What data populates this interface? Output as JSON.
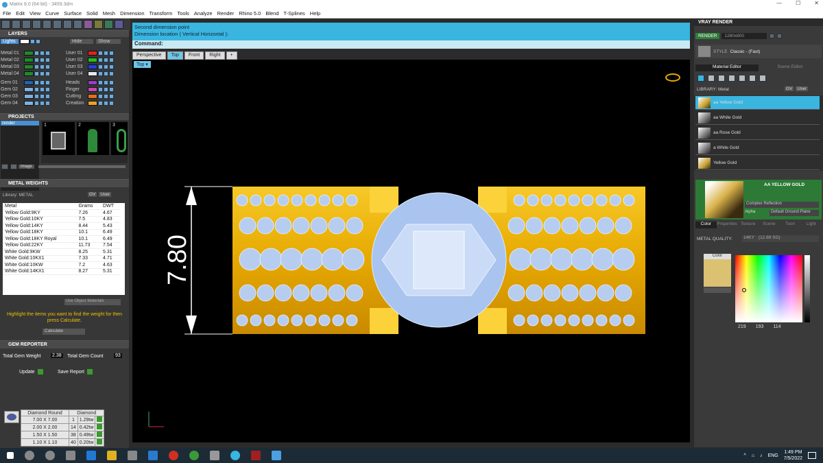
{
  "window": {
    "title": "Matrix 8.0 (64-bit) - 3459.3dm",
    "controls": [
      "—",
      "☐",
      "✕"
    ]
  },
  "menu": [
    "File",
    "Edit",
    "View",
    "Curve",
    "Surface",
    "Solid",
    "Mesh",
    "Dimension",
    "Transform",
    "Tools",
    "Analyze",
    "Render",
    "Rhino 5.0",
    "Blend",
    "T-Splines",
    "Help"
  ],
  "layers": {
    "title": "LAYERS",
    "lights": "Lights",
    "hide": "Hide",
    "show": "Show",
    "left_rows": [
      {
        "name": "Metal 01",
        "color": "#1e8a2a"
      },
      {
        "name": "Metal 02",
        "color": "#1e8a2a"
      },
      {
        "name": "Metal 03",
        "color": "#1e8a2a"
      },
      {
        "name": "Metal 04",
        "color": "#1e8a2a"
      },
      {
        "name": "Gem 01",
        "color": "#1e63b0"
      },
      {
        "name": "Gem 02",
        "color": "#7fb0e0"
      },
      {
        "name": "Gem 03",
        "color": "#7fb0e0"
      },
      {
        "name": "Gem 04",
        "color": "#7fb0e0"
      }
    ],
    "right_rows": [
      {
        "name": "User 01",
        "color": "#e02020"
      },
      {
        "name": "User 02",
        "color": "#20c020"
      },
      {
        "name": "User 03",
        "color": "#2040e0"
      },
      {
        "name": "User 04",
        "color": "#e8e8e8"
      },
      {
        "name": "Heads",
        "color": "#9a3cc0"
      },
      {
        "name": "Finger",
        "color": "#c04ab0"
      },
      {
        "name": "Cutting",
        "color": "#e07020"
      },
      {
        "name": "Creation",
        "color": "#f0a020"
      }
    ]
  },
  "projects": {
    "title": "PROJECTS",
    "item": "render",
    "thumbs": [
      "1",
      "2",
      "3"
    ],
    "image_label": "Image"
  },
  "metal_weights": {
    "title": "METAL WEIGHTS",
    "library_label": "Library: METAL",
    "gv": "GV",
    "user": "User",
    "headers": [
      "Metal",
      "Grams",
      "DWT"
    ],
    "rows": [
      [
        "Yellow Gold:9KY",
        "7.26",
        "4.67"
      ],
      [
        "Yellow Gold:10KY",
        "7.5",
        "4.83"
      ],
      [
        "Yellow Gold:14KY",
        "8.44",
        "5.43"
      ],
      [
        "Yellow Gold:18KY",
        "10.1",
        "6.49"
      ],
      [
        "Yellow Gold:18KY Royal",
        "10.1",
        "6.49"
      ],
      [
        "Yellow Gold:22KY",
        "11.73",
        "7.54"
      ],
      [
        "White Gold:9KW",
        "8.25",
        "5.31"
      ],
      [
        "White Gold:10KX1",
        "7.33",
        "4.71"
      ],
      [
        "White Gold:10KW",
        "7.2",
        "4.63"
      ],
      [
        "White Gold:14KX1",
        "8.27",
        "5.31"
      ]
    ],
    "use_object_materials": "Use Object Materials",
    "hint": "Highlight the items you want to find the weight for then press Calculate.",
    "calculate": "Calculate"
  },
  "gem_reporter": {
    "title": "GEM REPORTER",
    "total_weight_label": "Total Gem Weight",
    "total_weight": "2.38",
    "total_count_label": "Total Gem Count",
    "total_count": "93",
    "update": "Update",
    "save_report": "Save Report",
    "headers": [
      "Diamond Round",
      "Diamond"
    ],
    "rows": [
      [
        "7.00 X 7.00",
        "1",
        "1.29tw"
      ],
      [
        "2.00 X 2.00",
        "14",
        "0.42tw"
      ],
      [
        "1.50 X 1.50",
        "38",
        "0.49tw"
      ],
      [
        "1.10 X 1.10",
        "40",
        "0.20tw"
      ]
    ]
  },
  "command": {
    "line1": "Second dimension point",
    "line2": "Dimension location ( Vertical  Horizontal ):",
    "label": "Command:"
  },
  "viewport_tabs": [
    "Perspective",
    "Top",
    "Front",
    "Right"
  ],
  "active_tab": "Top",
  "viewport_label": "Top",
  "dimension": {
    "value": "7.80"
  },
  "vray": {
    "title": "VRAY RENDER",
    "render": "RENDER",
    "resolution": "1280x800",
    "style_label": "STYLE",
    "style": "Classic - (Fast)",
    "tabs": [
      "Material Editor",
      "Scene Editor"
    ],
    "library_label": "LIBRARY: Metal",
    "gv": "GV",
    "user": "User",
    "materials": [
      "aa Yellow Gold",
      "aa White Gold",
      "aa Rose Gold",
      "a White Gold",
      "Yellow Gold"
    ],
    "selected_name": "AA YELLOW GOLD",
    "reflection": "Complex Reflection",
    "alpha_label": "Alpha",
    "ground": "Default Ground Plane",
    "bottom_tabs": [
      "Color",
      "Properties",
      "Texture",
      "Scene",
      "Toon",
      "Light"
    ],
    "metal_quality_label": "METAL QUALITY:",
    "metal_quality": "14KY",
    "metal_quality_sg": "(12.89 SG)",
    "color_label": "Color",
    "swatch_color": "#dbc172",
    "rgb": [
      "219",
      "193",
      "114"
    ]
  },
  "taskbar": {
    "lang": "ENG",
    "time": "1:49 PM",
    "date": "7/5/2022"
  }
}
